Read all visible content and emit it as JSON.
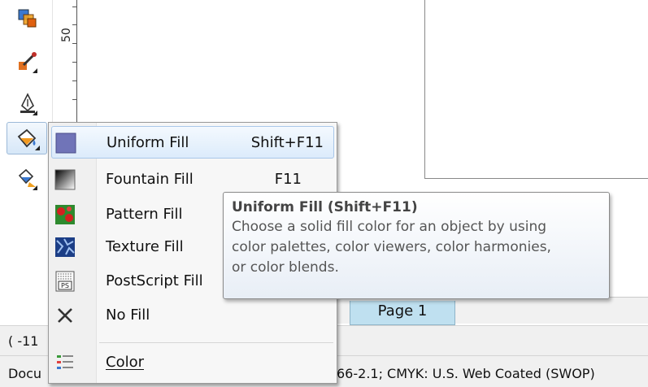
{
  "ruler": {
    "label": "50"
  },
  "toolbox": {
    "tools": [
      {
        "name": "transparency-tool-icon"
      },
      {
        "name": "eyedropper-tool-icon"
      },
      {
        "name": "outline-pen-tool-icon"
      },
      {
        "name": "fill-tool-icon"
      },
      {
        "name": "interactive-fill-tool-icon"
      }
    ]
  },
  "menu": {
    "items": [
      {
        "label": "Uniform Fill",
        "shortcut": "Shift+F11"
      },
      {
        "label": "Fountain Fill",
        "shortcut": "F11"
      },
      {
        "label": "Pattern Fill",
        "shortcut": ""
      },
      {
        "label": "Texture Fill",
        "shortcut": ""
      },
      {
        "label": "PostScript Fill",
        "shortcut": ""
      },
      {
        "label": "No Fill",
        "shortcut": ""
      },
      {
        "label": "Color",
        "shortcut": ""
      }
    ]
  },
  "tooltip": {
    "title": "Uniform Fill (Shift+F11)",
    "lines": [
      "Choose a solid fill color for an object by using",
      "color palettes, color viewers, color harmonies,",
      "or color blends."
    ]
  },
  "page_tab": {
    "label": "Page 1"
  },
  "status": {
    "coords": "( -11",
    "doc_left": "Docu",
    "doc_right": "66-2.1; CMYK: U.S. Web Coated (SWOP)"
  },
  "colors": {
    "uniform_swatch": "#7074b8",
    "highlight": "#dcebfb",
    "page_tab": "#bfe0f0"
  }
}
